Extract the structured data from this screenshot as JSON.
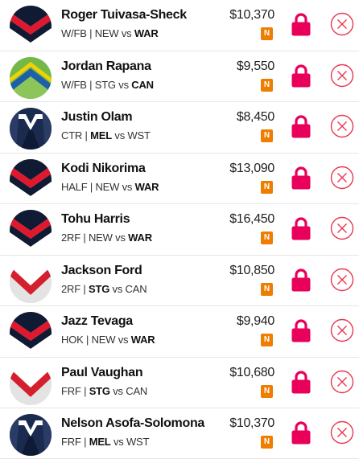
{
  "players": [
    {
      "name": "Roger Tuivasa-Sheck",
      "position": "W/FB",
      "home": "NEW",
      "vs": "vs",
      "away": "WAR",
      "bold": "away",
      "price": "$10,370",
      "badge": "N",
      "jersey": "roosters"
    },
    {
      "name": "Jordan Rapana",
      "position": "W/FB",
      "home": "STG",
      "vs": "vs",
      "away": "CAN",
      "bold": "away",
      "price": "$9,550",
      "badge": "N",
      "jersey": "raiders"
    },
    {
      "name": "Justin Olam",
      "position": "CTR",
      "home": "MEL",
      "vs": "vs",
      "away": "WST",
      "bold": "home",
      "price": "$8,450",
      "badge": "N",
      "jersey": "storm"
    },
    {
      "name": "Kodi Nikorima",
      "position": "HALF",
      "home": "NEW",
      "vs": "vs",
      "away": "WAR",
      "bold": "away",
      "price": "$13,090",
      "badge": "N",
      "jersey": "roosters"
    },
    {
      "name": "Tohu Harris",
      "position": "2RF",
      "home": "NEW",
      "vs": "vs",
      "away": "WAR",
      "bold": "away",
      "price": "$16,450",
      "badge": "N",
      "jersey": "roosters"
    },
    {
      "name": "Jackson Ford",
      "position": "2RF",
      "home": "STG",
      "vs": "vs",
      "away": "CAN",
      "bold": "home",
      "price": "$10,850",
      "badge": "N",
      "jersey": "dragons"
    },
    {
      "name": "Jazz Tevaga",
      "position": "HOK",
      "home": "NEW",
      "vs": "vs",
      "away": "WAR",
      "bold": "away",
      "price": "$9,940",
      "badge": "N",
      "jersey": "roosters"
    },
    {
      "name": "Paul Vaughan",
      "position": "FRF",
      "home": "STG",
      "vs": "vs",
      "away": "CAN",
      "bold": "home",
      "price": "$10,680",
      "badge": "N",
      "jersey": "dragons"
    },
    {
      "name": "Nelson Asofa-Solomona",
      "position": "FRF",
      "home": "MEL",
      "vs": "vs",
      "away": "WST",
      "bold": "home",
      "price": "$10,370",
      "badge": "N",
      "jersey": "storm"
    }
  ],
  "colors": {
    "lock": "#e8005a",
    "remove": "#e8384f",
    "badge": "#ee7d00"
  },
  "icons": {
    "lock": "lock-icon",
    "remove": "remove-icon"
  }
}
